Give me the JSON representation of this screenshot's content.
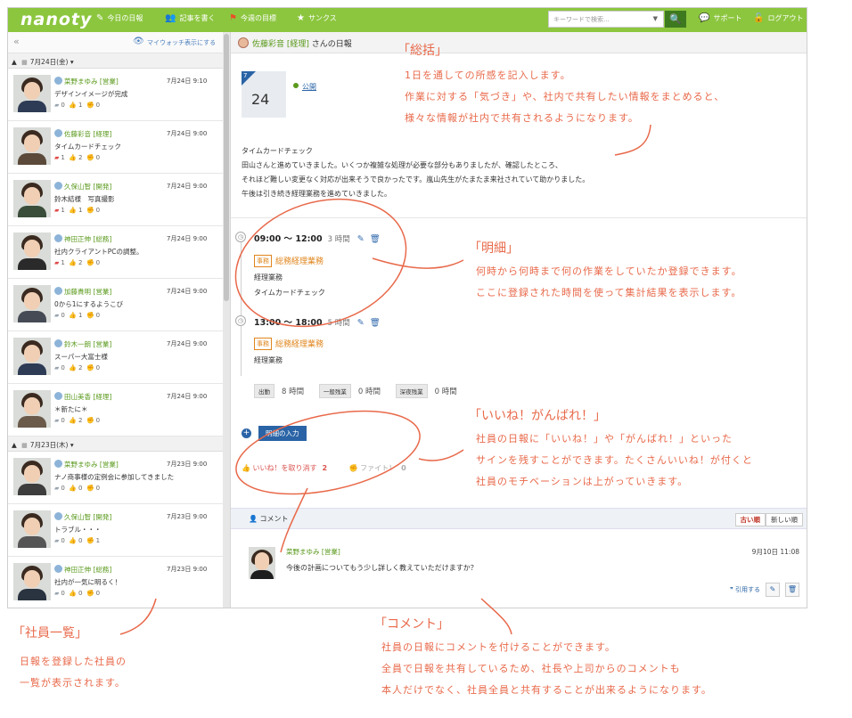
{
  "app": {
    "logo": "nanoty"
  },
  "nav": [
    {
      "label": "今日の日報"
    },
    {
      "label": "記事を書く"
    },
    {
      "label": "今週の目標"
    },
    {
      "label": "サンクス"
    }
  ],
  "search": {
    "placeholder": "キーワードで検索...",
    "button": "🔍"
  },
  "right_nav": [
    {
      "label": "サポート"
    },
    {
      "label": "ログアウト"
    }
  ],
  "left": {
    "collapse": "«",
    "mywatch": "マイウォッチ表示にする",
    "groups": [
      {
        "date": "7月24日(金)",
        "entries": [
          {
            "name": "菜野まゆみ",
            "dept": "[営業]",
            "date": "7月24日 9:10",
            "title": "デザインイメージが完成",
            "comments": "0",
            "likes": "1",
            "cheers": "0"
          },
          {
            "name": "佐藤彩音",
            "dept": "[経理]",
            "date": "7月24日 9:00",
            "title": "タイムカードチェック",
            "comments": "1",
            "likes": "2",
            "cheers": "0"
          },
          {
            "name": "久保山智",
            "dept": "[開発]",
            "date": "7月24日 9:00",
            "title": "鈴木結様　写真撮影",
            "comments": "1",
            "likes": "1",
            "cheers": "0"
          },
          {
            "name": "神田正伸",
            "dept": "[総務]",
            "date": "7月24日 9:00",
            "title": "社内クライアントPCの調整。",
            "comments": "1",
            "likes": "2",
            "cheers": "0"
          },
          {
            "name": "加藤貴明",
            "dept": "[営業]",
            "date": "7月24日 9:00",
            "title": "0から1にするようこび",
            "comments": "0",
            "likes": "1",
            "cheers": "0"
          },
          {
            "name": "鈴木一朗",
            "dept": "[営業]",
            "date": "7月24日 9:00",
            "title": "スーパー大富士様",
            "comments": "0",
            "likes": "2",
            "cheers": "0"
          },
          {
            "name": "田山美香",
            "dept": "[経理]",
            "date": "7月24日 9:00",
            "title": "＊新たに＊",
            "comments": "0",
            "likes": "2",
            "cheers": "0"
          }
        ]
      },
      {
        "date": "7月23日(木)",
        "entries": [
          {
            "name": "菜野まゆみ",
            "dept": "[営業]",
            "date": "7月23日 9:00",
            "title": "ナノ商事様の定例会に参加してきました",
            "comments": "0",
            "likes": "0",
            "cheers": "0"
          },
          {
            "name": "久保山智",
            "dept": "[開発]",
            "date": "7月23日 9:00",
            "title": "トラブル・・・",
            "comments": "0",
            "likes": "0",
            "cheers": "1"
          },
          {
            "name": "神田正伸",
            "dept": "[総務]",
            "date": "7月23日 9:00",
            "title": "社内が一気に明るく！",
            "comments": "0",
            "likes": "0",
            "cheers": "0"
          }
        ]
      }
    ]
  },
  "main": {
    "author": "佐藤彩音",
    "dept": "[経理]",
    "suffix": "さんの日報",
    "cal_month": "7",
    "cal_day": "24",
    "visibility": "公開",
    "summary_lines": [
      "タイムカードチェック",
      "田山さんと進めていきました。いくつか複雑な処理が必要な部分もありましたが、確認したところ、",
      "それほど難しい変更なく対応が出来そうで良かったです。嵐山先生がたまたま来社されていて助かりました。",
      "午後は引き続き経理業務を進めていきました。"
    ],
    "details": [
      {
        "time": "09:00 ～ 12:00",
        "hours": "3 時間",
        "tag": "事務",
        "category": "総務経理業務",
        "lines": [
          "経理業務",
          "タイムカードチェック"
        ]
      },
      {
        "time": "13:00 ～ 18:00",
        "hours": "5 時間",
        "tag": "事務",
        "category": "総務経理業務",
        "lines": [
          "経理業務"
        ]
      }
    ],
    "totals": [
      {
        "label": "出勤",
        "value": "8 時間"
      },
      {
        "label": "一般残業",
        "value": "0 時間"
      },
      {
        "label": "深夜残業",
        "value": "0 時間"
      }
    ],
    "add_detail": "明細の入力",
    "like_label": "いいね！を取り消す",
    "like_count": "2",
    "fight_label": "ファイト！",
    "fight_count": "0",
    "comment_header": "コメント",
    "sort_old": "古い順",
    "sort_new": "新しい順",
    "comment": {
      "name": "菜野まゆみ",
      "dept": "[営業]",
      "date": "9月10日 11:08",
      "text": "今後の計画についてもう少し詳しく教えていただけますか？",
      "quote": "引用する"
    }
  },
  "annotations": {
    "soukatsu_title": "「総括」",
    "soukatsu_lines": [
      "1日を通しての所感を記入します。",
      "作業に対する「気づき」や、社内で共有したい情報をまとめると、",
      "様々な情報が社内で共有されるようになります。"
    ],
    "meisai_title": "「明細」",
    "meisai_lines": [
      "何時から何時まで何の作業をしていたか登録できます。",
      "ここに登録された時間を使って集計結果を表示します。"
    ],
    "iine_title": "「いいね！がんばれ！」",
    "iine_lines": [
      "社員の日報に「いいね！」や「がんばれ！」といった",
      "サインを残すことができます。たくさんいいね！が付くと",
      "社員のモチベーションは上がっていきます。"
    ],
    "shain_title": "「社員一覧」",
    "shain_lines": [
      "日報を登録した社員の",
      "一覧が表示されます。"
    ],
    "comment_title": "「コメント」",
    "comment_lines": [
      "社員の日報にコメントを付けることができます。",
      "全員で日報を共有しているため、社長や上司からのコメントも",
      "本人だけでなく、社員全員と共有することが出来るようになります。"
    ],
    "color": "#e8694a"
  }
}
